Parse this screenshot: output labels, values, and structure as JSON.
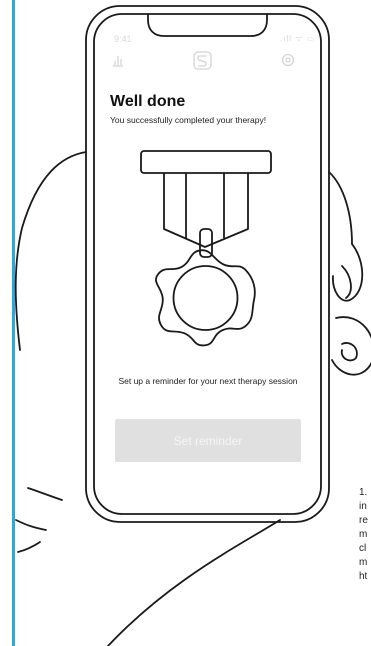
{
  "status_bar": {
    "time": "9:41",
    "indicators": ".ıll ᯤ ▭"
  },
  "top_bar": {
    "stats_icon": "bar-chart-icon",
    "logo_icon": "app-logo-icon",
    "settings_icon": "settings-icon"
  },
  "screen": {
    "title": "Well done",
    "subtitle": "You successfully completed your therapy!",
    "illustration": "medal-icon",
    "reminder_text": "Set up a reminder for your next therapy session",
    "button_label": "Set reminder"
  },
  "side_note": {
    "lines": "1.\nin\nre\nm\ncl\nm\nht"
  },
  "colors": {
    "accent_rule": "#2aa8e0",
    "button_bg": "#e0e0e0",
    "button_text": "#f5f5f5"
  }
}
